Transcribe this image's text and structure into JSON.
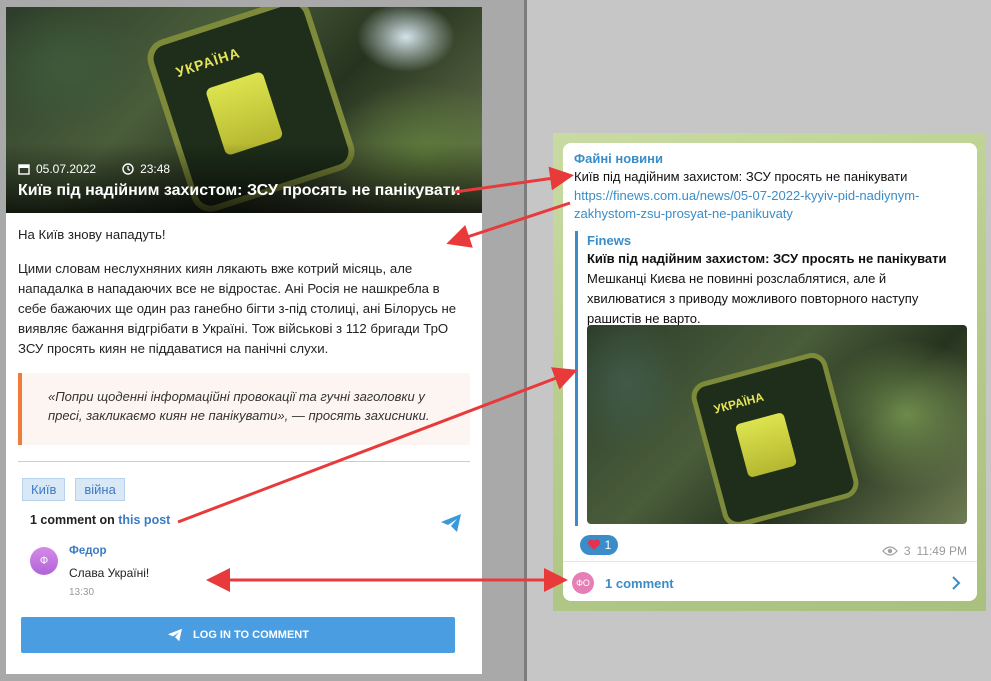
{
  "article": {
    "date": "05.07.2022",
    "time": "23:48",
    "patch_text": "УКРАЇНА",
    "title": "Київ під надійним захистом: ЗСУ просять не панікувати",
    "paragraph1": "На Київ знову нападуть!",
    "paragraph2": "Цими словам неслухняних киян лякають вже котрий місяць, але нападалка в нападаючих все не відростає. Ані Росія не нашкребла в себе бажаючих ще один раз ганебно бігти з-під столиці, ані Білорусь не виявляє бажання відгрібати в Україні. Тож військові з 112 бригади ТрО ЗСУ просять киян не піддаватися на панічні слухи.",
    "quote": "«Попри щоденні інформаційні провокації та гучні заголовки у пресі, закликаємо киян не панікувати», — просять захисники.",
    "tags": [
      "Київ",
      "війна"
    ],
    "comments_head_prefix": "1 comment on",
    "comments_head_link": "this post",
    "comment": {
      "avatar_letter": "Ф",
      "author": "Федор",
      "text": "Слава Україні!",
      "time": "13:30"
    },
    "login_label": "LOG IN TO COMMENT"
  },
  "telegram": {
    "channel": "Файні новини",
    "message_line": "Київ під надійним захистом: ЗСУ просять не панікувати",
    "url": "https://finews.com.ua/news/05-07-2022-kyyiv-pid-nadiynym-zakhystom-zsu-prosyat-ne-panikuvaty",
    "preview": {
      "site": "Finews",
      "title": "Київ під надійним захистом: ЗСУ просять не панікувати",
      "description": "Мешканці Києва не повинні розслаблятися, але й хвилюватися з приводу можливого повторного наступу рашистів не варто.",
      "patch_text": "УКРАЇНА"
    },
    "reaction_count": "1",
    "views": "3",
    "time": "11:49 PM",
    "comment_avatar": "ФО",
    "comment_count": "1 comment"
  },
  "colors": {
    "accent_blue": "#3a8dc8",
    "quote_border": "#f07c3c",
    "arrow_red": "#e83a3a"
  }
}
